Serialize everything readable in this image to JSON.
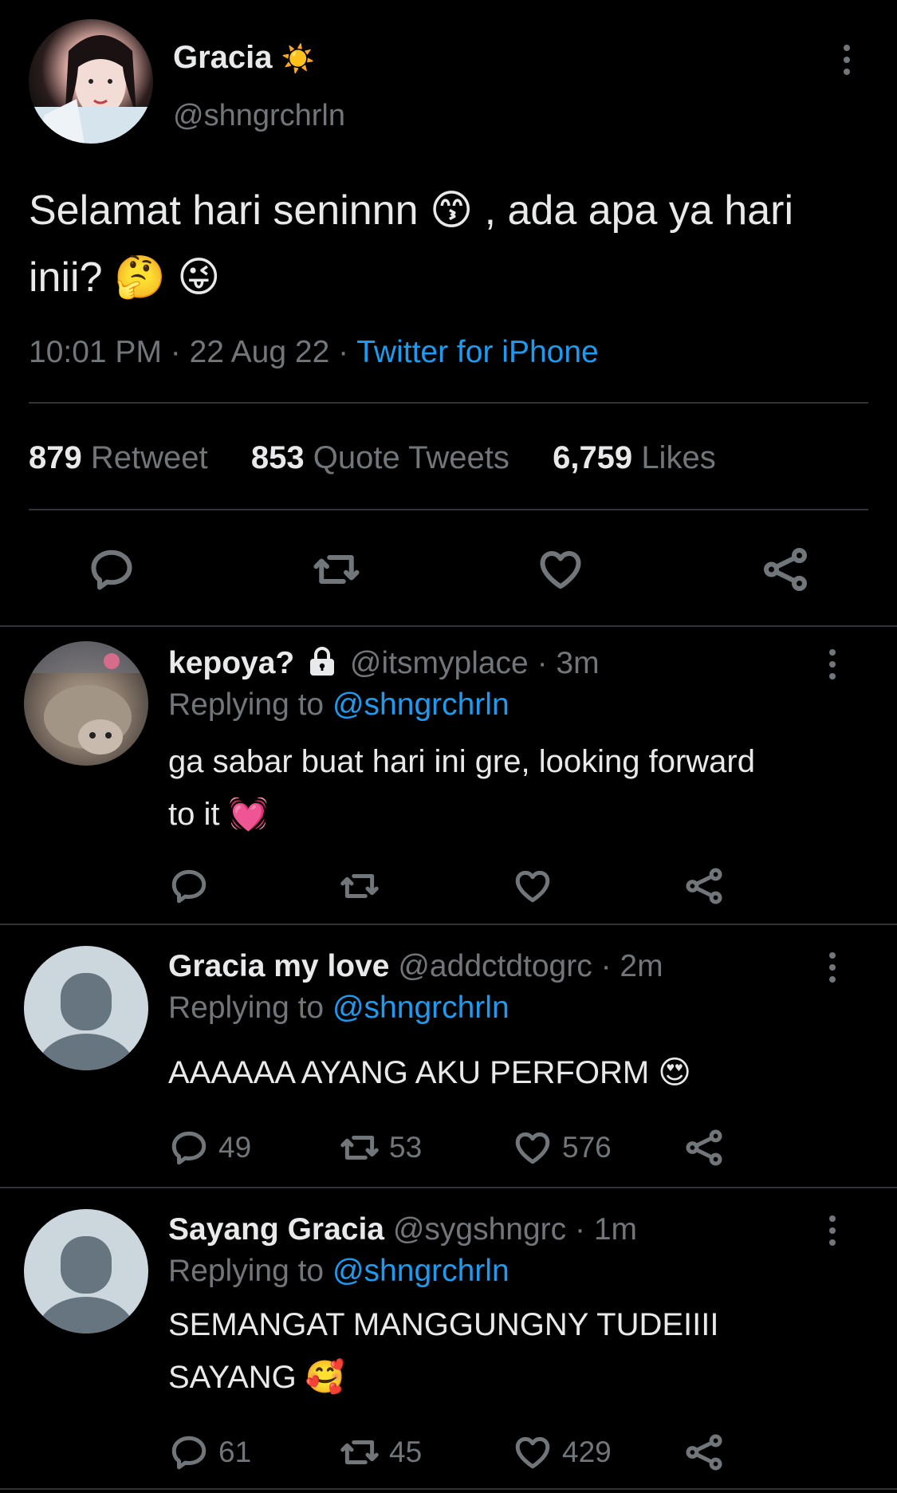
{
  "main_tweet": {
    "display_name": "Gracia",
    "name_emoji": "☀️",
    "handle": "@shngrchrln",
    "text_line1": "Selamat hari seninnn 😙 , ada apa ya hari",
    "text_line2": "inii? 🤔 😜",
    "time": "10:01 PM",
    "date": "22 Aug 22",
    "source": "Twitter for iPhone",
    "stats": {
      "retweets_count": "879",
      "retweets_label": "Retweet",
      "quotes_count": "853",
      "quotes_label": "Quote Tweets",
      "likes_count": "6,759",
      "likes_label": "Likes"
    }
  },
  "replies": [
    {
      "display_name": "kepoya?",
      "name_icon": "lock-icon",
      "handle": "@itsmyplace",
      "time": "· 3m",
      "replying_label": "Replying to",
      "replying_handle": "@shngrchrln",
      "text_line1": "ga sabar buat hari ini gre, looking forward",
      "text_line2": "to it 💓",
      "reply_count": "",
      "retweet_count": "",
      "like_count": ""
    },
    {
      "display_name": "Gracia my love",
      "handle": "@addctdtogrc",
      "time": "· 2m",
      "replying_label": "Replying to",
      "replying_handle": "@shngrchrln",
      "text_line1": "AAAAAA AYANG AKU PERFORM 😍",
      "reply_count": "49",
      "retweet_count": "53",
      "like_count": "576"
    },
    {
      "display_name": "Sayang Gracia",
      "handle": "@sygshngrc",
      "time": "· 1m",
      "replying_label": "Replying to",
      "replying_handle": "@shngrchrln",
      "text_line1": "SEMANGAT MANGGUNGNY TUDEIIII",
      "text_line2": "SAYANG 🥰",
      "reply_count": "61",
      "retweet_count": "45",
      "like_count": "429"
    }
  ],
  "colors": {
    "background": "#000000",
    "text": "#e7e9ea",
    "secondary": "#71767b",
    "link": "#1d9bf0",
    "divider": "#2f3336"
  }
}
